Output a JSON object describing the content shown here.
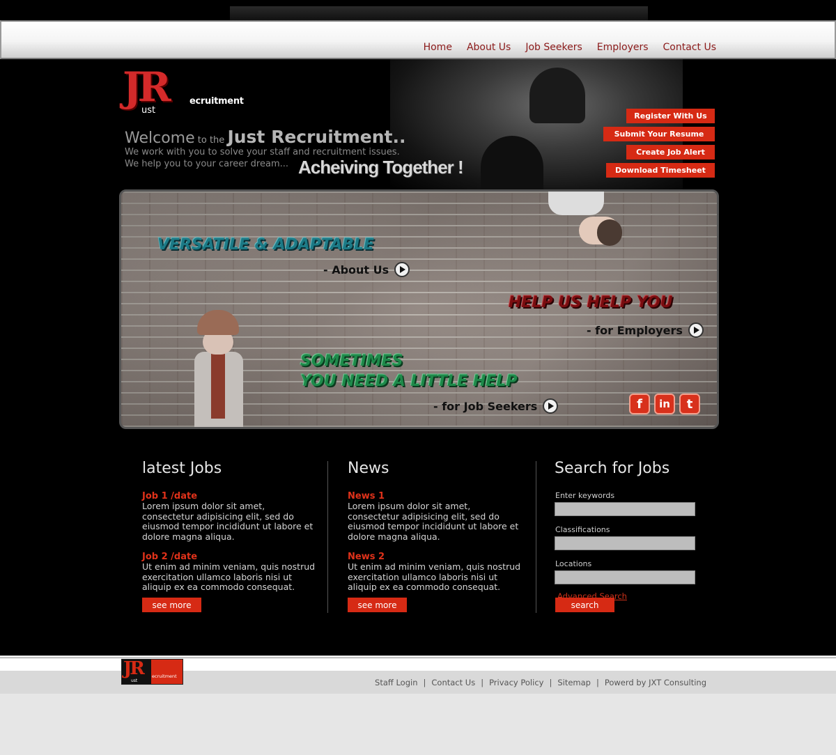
{
  "nav": {
    "items": [
      "Home",
      "About Us",
      "Job Seekers",
      "Employers",
      "Contact Us"
    ]
  },
  "brand": {
    "logo_big": "JR",
    "logo_ust": "ust",
    "logo_ecr": "ecruitment"
  },
  "welcome": {
    "w1": "Welcome",
    "w2": " to the ",
    "w3": "Just Recruitment..",
    "line1": "We work with you to solve your staff and recruitment issues.",
    "line2": "We help you to your career dream...",
    "tagline": "Acheiving Together !"
  },
  "side_buttons": [
    "Register With Us",
    "Submit Your Resume",
    "Create Job Alert",
    "Download Timesheet"
  ],
  "banner": {
    "h1": "VERSATILE & ADAPTABLE",
    "cta1": "- About Us",
    "h2": "HELP US HELP YOU",
    "cta2": "- for Employers",
    "h3a": "SOMETIMES",
    "h3b": "YOU NEED A LITTLE HELP",
    "cta3": "- for Job Seekers"
  },
  "social": {
    "facebook": "f",
    "linkedin": "in",
    "twitter": "t"
  },
  "latest_jobs": {
    "title": "latest Jobs",
    "items": [
      {
        "title": "Job 1   /date",
        "text": "Lorem ipsum dolor sit amet, consectetur adipisicing elit, sed do eiusmod tempor incididunt ut labore et dolore magna aliqua."
      },
      {
        "title": "Job 2   /date",
        "text": "Ut enim ad minim veniam, quis nostrud exercitation ullamco laboris nisi ut aliquip ex ea commodo consequat."
      }
    ],
    "see_more": "see more"
  },
  "news": {
    "title": "News",
    "items": [
      {
        "title": "News 1",
        "text": "Lorem ipsum dolor sit amet, consectetur adipisicing elit, sed do eiusmod tempor incididunt ut labore et dolore magna aliqua."
      },
      {
        "title": "News 2",
        "text": "Ut enim ad minim veniam, quis nostrud exercitation ullamco laboris nisi ut aliquip ex ea commodo consequat."
      }
    ],
    "see_more": "see more"
  },
  "search": {
    "title": "Search for Jobs",
    "keywords_label": "Enter keywords",
    "classifications_label": "Classifications",
    "locations_label": "Locations",
    "advanced": "Advanced Search",
    "button": "search"
  },
  "footer": {
    "logo_jr": "JR",
    "logo_ust": "ust",
    "logo_ecr": "ecruitment",
    "links": [
      "Staff Login",
      "Contact Us",
      "Privacy Policy",
      "Sitemap",
      "Powerd by JXT Consulting"
    ],
    "sep": "|"
  },
  "colors": {
    "accent": "#d62a14",
    "nav_text": "#8b1a1a",
    "background": "#000000"
  }
}
